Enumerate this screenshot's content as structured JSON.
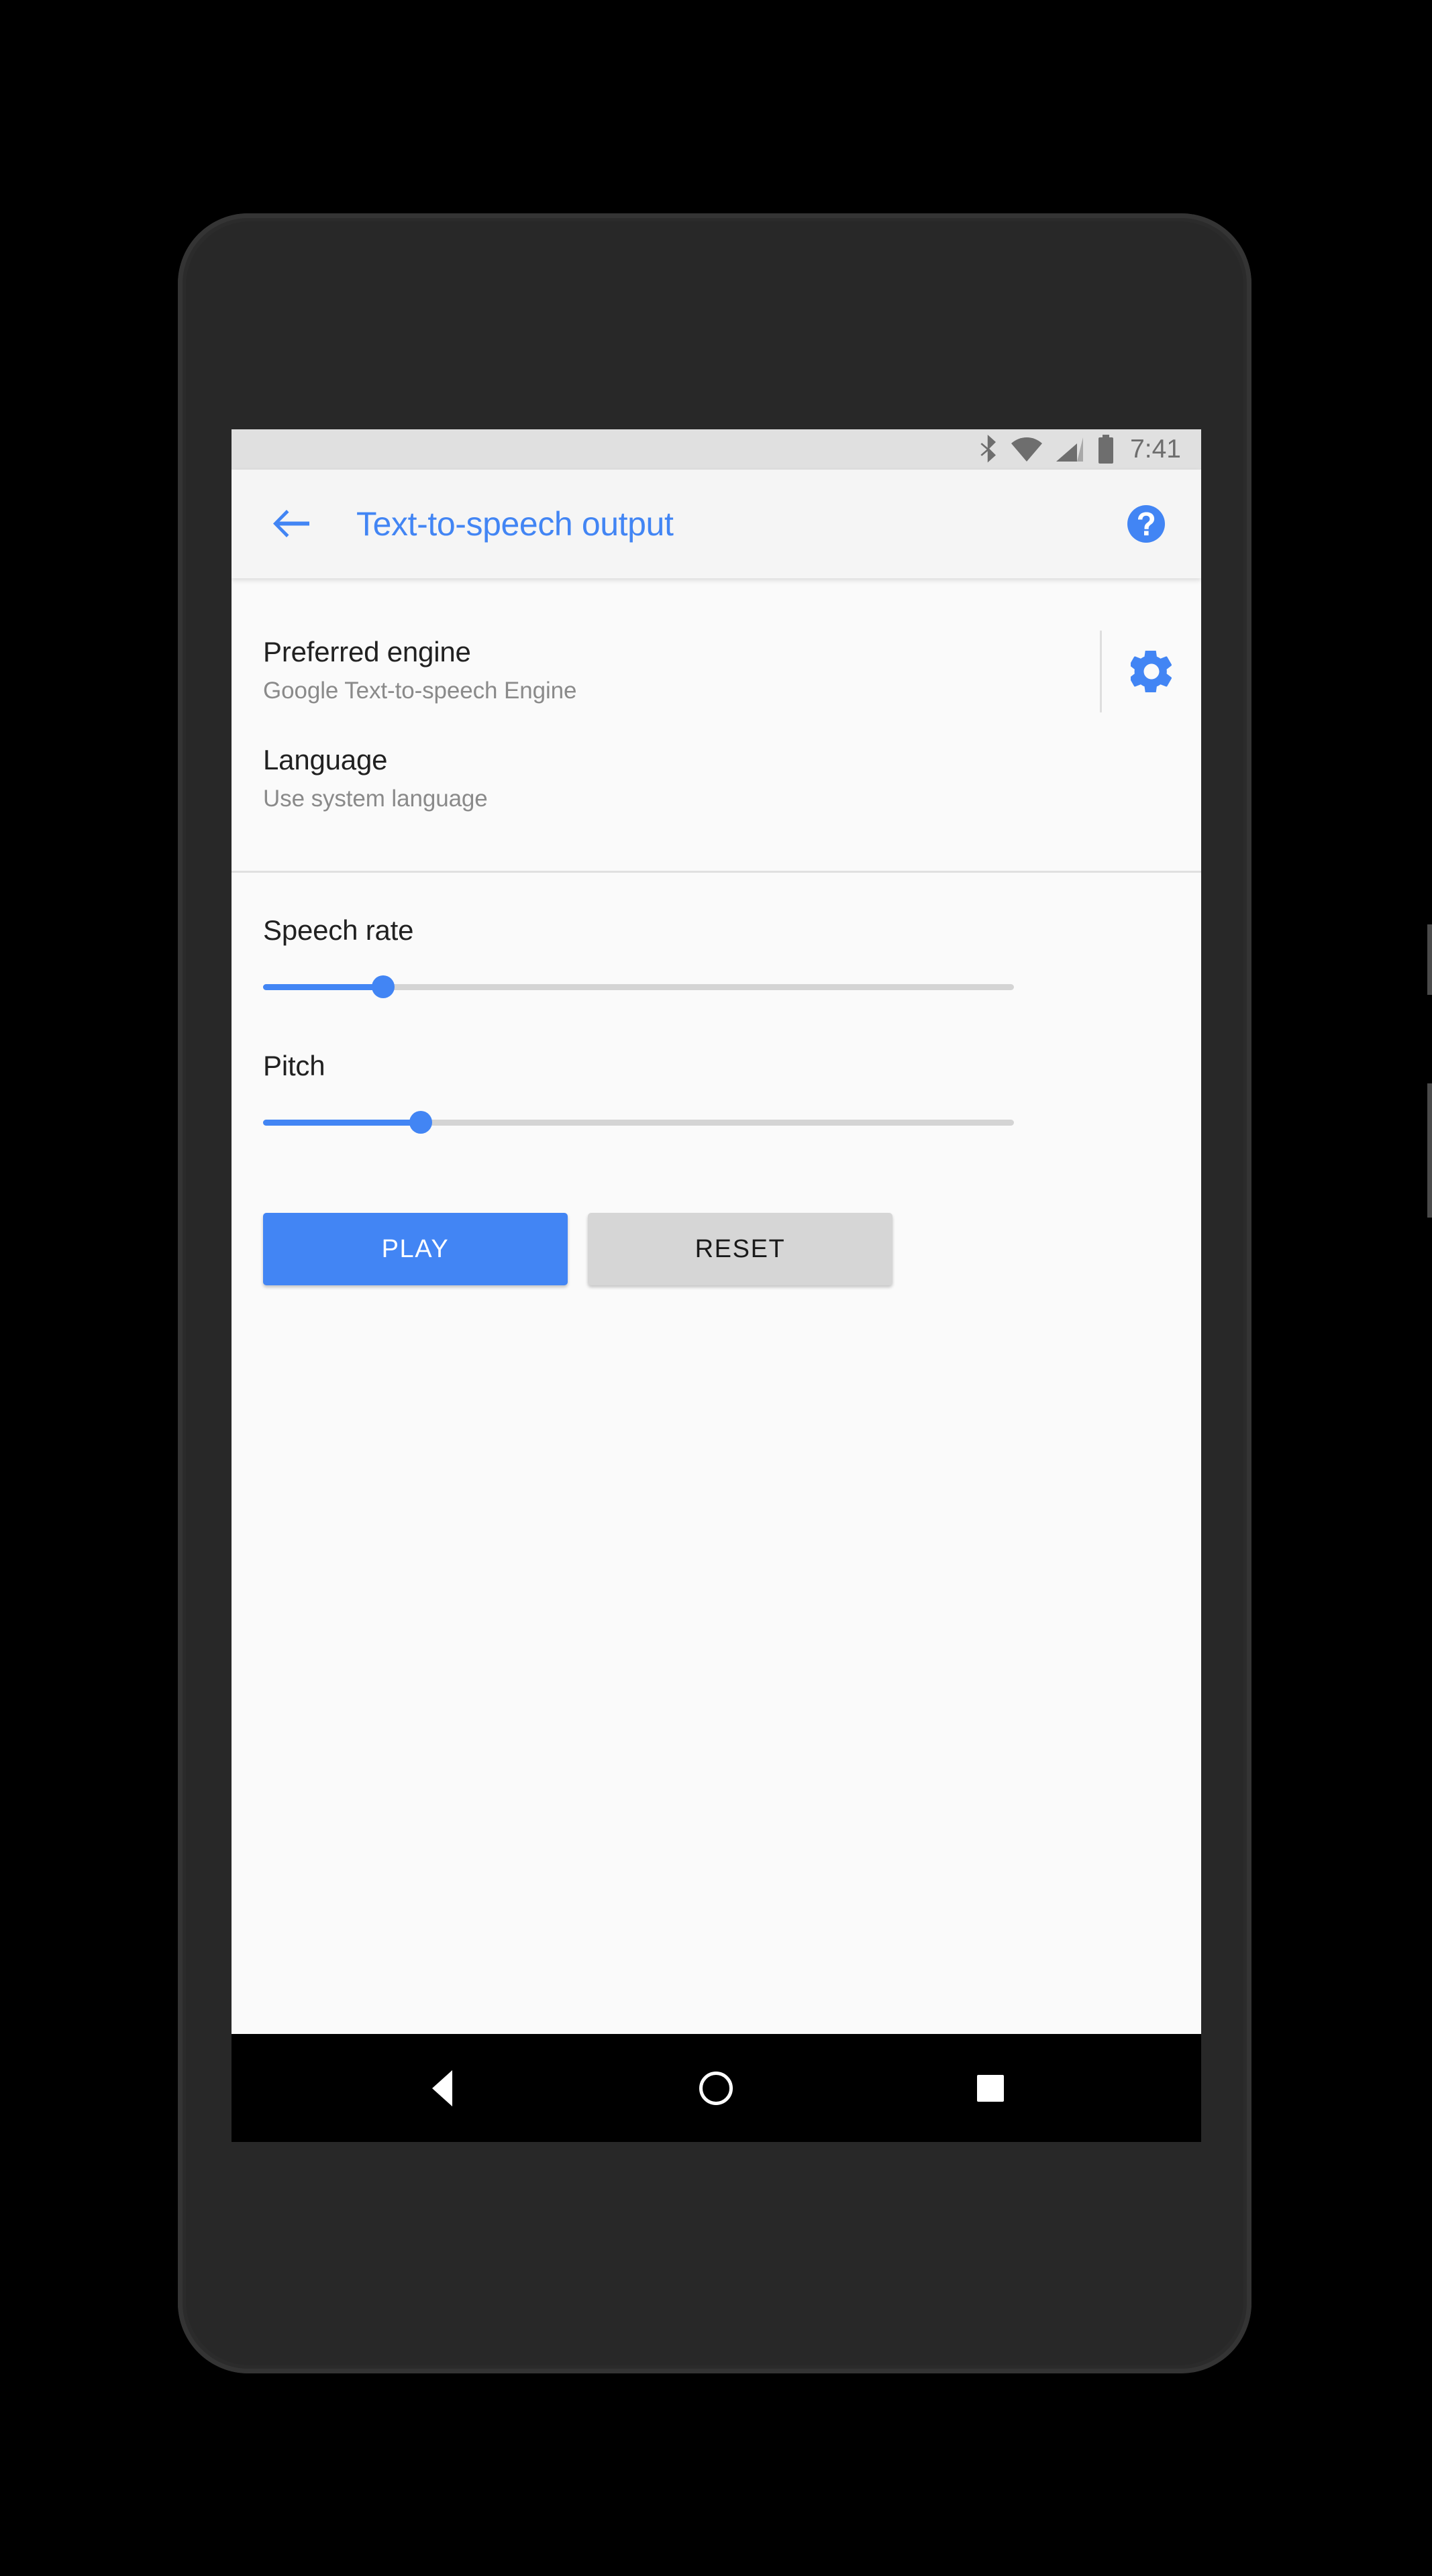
{
  "device": {
    "type": "android-phone-mockup",
    "frame_color": "#2b2b2b"
  },
  "status_bar": {
    "background": "#e0e0e0",
    "icon_color": "#6e6e6e",
    "time": "7:41",
    "icons": [
      "bluetooth-icon",
      "wifi-icon",
      "cellular-signal-icon",
      "battery-icon"
    ]
  },
  "toolbar": {
    "background": "#f5f5f5",
    "accent": "#4285f4",
    "back_label": "Navigate up",
    "title": "Text-to-speech output",
    "help_label": "Help"
  },
  "settings": {
    "preferred_engine": {
      "title": "Preferred engine",
      "summary": "Google Text-to-speech Engine",
      "action_icon": "gear-icon",
      "action_label": "Engine settings"
    },
    "language": {
      "title": "Language",
      "summary": "Use system language"
    }
  },
  "sliders": [
    {
      "label": "Speech rate",
      "name": "speech-rate-slider",
      "value_percent": 16,
      "fill_color": "#4285f4",
      "track_color": "#d4d4d4"
    },
    {
      "label": "Pitch",
      "name": "pitch-slider",
      "value_percent": 21,
      "fill_color": "#4285f4",
      "track_color": "#d4d4d4"
    }
  ],
  "actions": {
    "play_label": "PLAY",
    "play_color": "#4285f4",
    "reset_label": "RESET",
    "reset_color": "#d6d6d6"
  },
  "nav_bar": {
    "background": "#000000",
    "back_label": "Back",
    "home_label": "Home",
    "recents_label": "Recent apps"
  }
}
